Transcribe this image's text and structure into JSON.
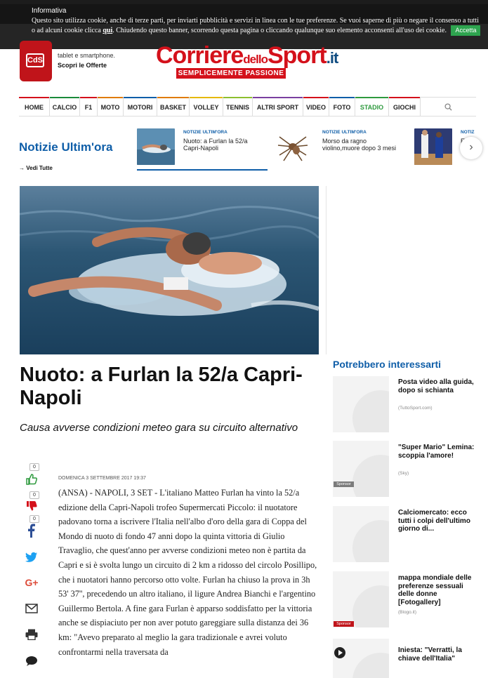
{
  "cookie_banner": {
    "title": "Informativa",
    "text_before_link": "Questo sito utilizza cookie, anche di terze parti, per inviarti pubblicità e servizi in linea con le tue preferenze. Se vuoi saperne di più o negare il consenso a tutti o ad alcuni cookie clicca ",
    "link": "qui",
    "text_after_link": ". Chiudendo questo banner, scorrendo questa pagina o cliccando qualunque suo elemento acconsenti all'uso dei cookie.",
    "accept_label": "Accetta"
  },
  "header": {
    "promo_line1": "tablet e smartphone.",
    "promo_line2": "Scopri le Offerte",
    "promo_icon_label": "CdS",
    "logo_main": "Corriere",
    "logo_small": "dello",
    "logo_end": "Sport",
    "logo_suffix": ".it",
    "tagline": "SEMPLICEMENTE PASSIONE"
  },
  "nav": {
    "items": [
      {
        "label": "HOME",
        "color": "#d4111b"
      },
      {
        "label": "CALCIO",
        "color": "#1a8a3a"
      },
      {
        "label": "F1",
        "color": "#d4111b"
      },
      {
        "label": "MOTO",
        "color": "#e07b00"
      },
      {
        "label": "MOTORI",
        "color": "#0f5ea8"
      },
      {
        "label": "BASKET",
        "color": "#e07b00"
      },
      {
        "label": "VOLLEY",
        "color": "#e6b800"
      },
      {
        "label": "TENNIS",
        "color": "#8dbf2e"
      },
      {
        "label": "ALTRI SPORT",
        "color": "#7a3fa0"
      },
      {
        "label": "VIDEO",
        "color": "#d4111b"
      },
      {
        "label": "FOTO",
        "color": "#0f5ea8"
      },
      {
        "label": "STADIO",
        "color": "#2e9a3e"
      },
      {
        "label": "GIOCHI",
        "color": "#d4111b"
      }
    ]
  },
  "ultim_ora": {
    "title": "Notizie Ultim'ora",
    "vedi_tutte": "→ Vedi Tutte",
    "items": [
      {
        "kicker": "NOTIZIE ULTIM'ORA",
        "title": "Nuoto: a Furlan la 52/a Capri-Napoli"
      },
      {
        "kicker": "NOTIZIE ULTIM'ORA",
        "title": "Morso da ragno violino,muore dopo 3 mesi"
      },
      {
        "kicker": "NOTIZ",
        "title": "Euro"
      }
    ]
  },
  "article": {
    "headline": "Nuoto: a Furlan la 52/a Capri-Napoli",
    "subhead": "Causa avverse condizioni meteo gara su circuito alternativo",
    "date": "DOMENICA 3 SETTEMBRE 2017 19:37",
    "body": "(ANSA) - NAPOLI, 3 SET - L'italiano Matteo Furlan ha vinto la 52/a edizione della Capri-Napoli trofeo Supermercati Piccolo: il nuotatore padovano torna a iscrivere l'Italia nell'albo d'oro della gara di Coppa del Mondo di nuoto di fondo 47 anni dopo la quinta vittoria di Giulio Travaglio, che quest'anno per avverse condizioni meteo non è partita da Capri e si è svolta lungo un circuito di 2 km a ridosso del circolo Posillipo, che i nuotatori hanno percorso otto volte. Furlan ha chiuso la prova in 3h 53' 37'', precedendo un altro italiano, il ligure Andrea Bianchi e l'argentino Guillermo Bertola. A fine gara Furlan è apparso soddisfatto per la vittoria anche se dispiaciuto per non aver potuto gareggiare sulla distanza dei 36 km: \"Avevo preparato al meglio la gara tradizionale e avrei voluto confrontarmi nella traversata da"
  },
  "share": {
    "like_count": "0",
    "dislike_count": "0",
    "facebook_count": "0"
  },
  "sidebar": {
    "title": "Potrebbero interessarti",
    "items": [
      {
        "title": "Posta video alla guida, dopo si schianta",
        "source": "(TuttoSport.com)",
        "sponsor": ""
      },
      {
        "title": "\"Super Mario\" Lemina: scoppia l'amore!",
        "source": "(Sky)",
        "sponsor": "Sponsor"
      },
      {
        "title": "Calciomercato: ecco tutti i colpi dell'ultimo giorno di...",
        "source": "",
        "sponsor": ""
      },
      {
        "title": "mappa mondiale delle preferenze sessuali delle donne [Fotogallery]",
        "source": "(Blogo.it)",
        "sponsor": "Sponsor"
      },
      {
        "title": "Iniesta: \"Verratti, la chiave dell'Italia\"",
        "source": "",
        "sponsor": ""
      }
    ]
  },
  "colors": {
    "brand_red": "#d4111b",
    "accent_blue": "#0f5ea8"
  }
}
